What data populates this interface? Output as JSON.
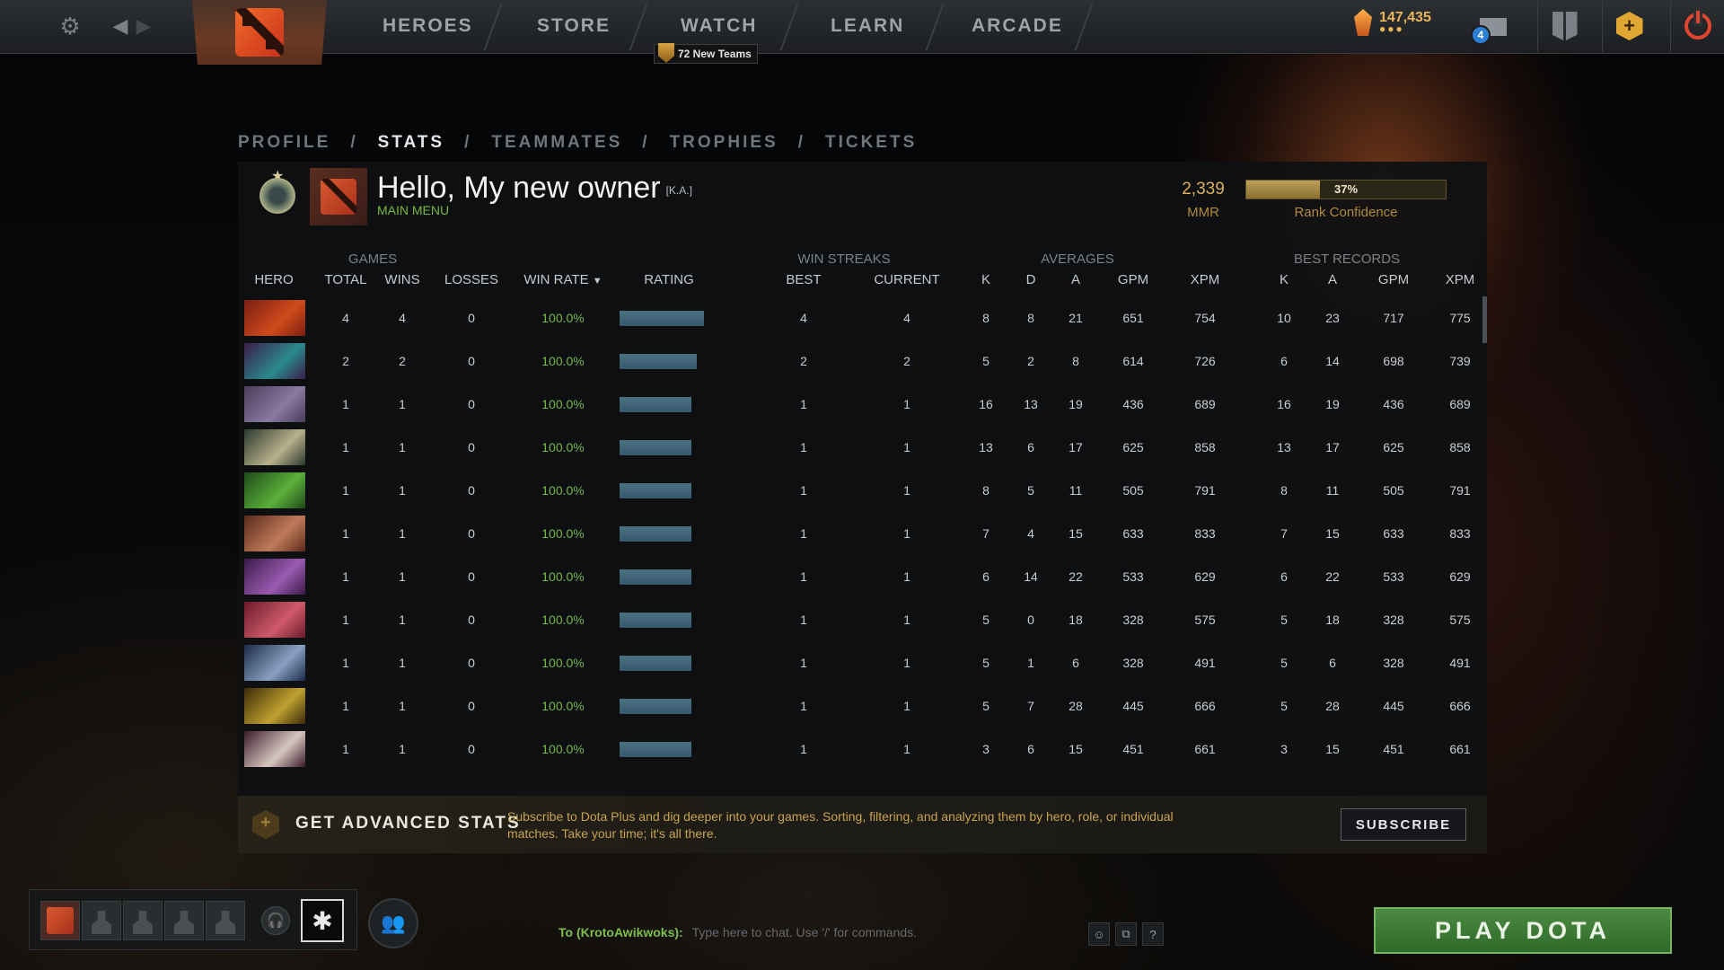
{
  "nav": {
    "items": [
      "HEROES",
      "STORE",
      "WATCH",
      "LEARN",
      "ARCADE"
    ],
    "new_teams": "72 New Teams",
    "shards": "147,435",
    "shard_dots": "●●●",
    "mail_count": "4"
  },
  "breadcrumb": {
    "items": [
      "PROFILE",
      "STATS",
      "TEAMMATES",
      "TROPHIES",
      "TICKETS"
    ],
    "separator": "/",
    "active": "STATS"
  },
  "profile": {
    "name": "Hello, My new owner",
    "tag": "[K.A.]",
    "status": "MAIN MENU",
    "mmr_value": "2,339",
    "mmr_label": "MMR",
    "confidence_pct": "37%",
    "confidence_fraction": 0.37,
    "confidence_label": "Rank Confidence"
  },
  "table": {
    "groups": {
      "games": "GAMES",
      "win_streaks": "WIN STREAKS",
      "averages": "AVERAGES",
      "best_records": "BEST RECORDS"
    },
    "headers": {
      "hero": "HERO",
      "total": "TOTAL",
      "wins": "WINS",
      "losses": "LOSSES",
      "win_rate": "WIN RATE",
      "rating": "RATING",
      "best": "BEST",
      "current": "CURRENT",
      "avg_k": "K",
      "avg_d": "D",
      "avg_a": "A",
      "avg_gpm": "GPM",
      "avg_xpm": "XPM",
      "rec_k": "K",
      "rec_a": "A",
      "rec_gpm": "GPM",
      "rec_xpm": "XPM"
    },
    "rows": [
      {
        "total": "4",
        "wins": "4",
        "losses": "0",
        "win_rate": "100.0%",
        "rating": 1.0,
        "best": "4",
        "current": "4",
        "k": "8",
        "d": "8",
        "a": "21",
        "gpm": "651",
        "xpm": "754",
        "rk": "10",
        "ra": "23",
        "rgpm": "717",
        "rxpm": "775",
        "colors": [
          "#7a1e14",
          "#d04b1c"
        ]
      },
      {
        "total": "2",
        "wins": "2",
        "losses": "0",
        "win_rate": "100.0%",
        "rating": 0.91,
        "best": "2",
        "current": "2",
        "k": "5",
        "d": "2",
        "a": "8",
        "gpm": "614",
        "xpm": "726",
        "rk": "6",
        "ra": "14",
        "rgpm": "698",
        "rxpm": "739",
        "colors": [
          "#3a1e4a",
          "#2a8a8c"
        ]
      },
      {
        "total": "1",
        "wins": "1",
        "losses": "0",
        "win_rate": "100.0%",
        "rating": 0.85,
        "best": "1",
        "current": "1",
        "k": "16",
        "d": "13",
        "a": "19",
        "gpm": "436",
        "xpm": "689",
        "rk": "16",
        "ra": "19",
        "rgpm": "436",
        "rxpm": "689",
        "colors": [
          "#4a3a5a",
          "#8a7aa0"
        ]
      },
      {
        "total": "1",
        "wins": "1",
        "losses": "0",
        "win_rate": "100.0%",
        "rating": 0.85,
        "best": "1",
        "current": "1",
        "k": "13",
        "d": "6",
        "a": "17",
        "gpm": "625",
        "xpm": "858",
        "rk": "13",
        "ra": "17",
        "rgpm": "625",
        "rxpm": "858",
        "colors": [
          "#2a3a2e",
          "#b8b08a"
        ]
      },
      {
        "total": "1",
        "wins": "1",
        "losses": "0",
        "win_rate": "100.0%",
        "rating": 0.85,
        "best": "1",
        "current": "1",
        "k": "8",
        "d": "5",
        "a": "11",
        "gpm": "505",
        "xpm": "791",
        "rk": "8",
        "ra": "11",
        "rgpm": "505",
        "rxpm": "791",
        "colors": [
          "#1e4a1a",
          "#5ab03a"
        ]
      },
      {
        "total": "1",
        "wins": "1",
        "losses": "0",
        "win_rate": "100.0%",
        "rating": 0.85,
        "best": "1",
        "current": "1",
        "k": "7",
        "d": "4",
        "a": "15",
        "gpm": "633",
        "xpm": "833",
        "rk": "7",
        "ra": "15",
        "rgpm": "633",
        "rxpm": "833",
        "colors": [
          "#5a2a1a",
          "#c07a5a"
        ]
      },
      {
        "total": "1",
        "wins": "1",
        "losses": "0",
        "win_rate": "100.0%",
        "rating": 0.85,
        "best": "1",
        "current": "1",
        "k": "6",
        "d": "14",
        "a": "22",
        "gpm": "533",
        "xpm": "629",
        "rk": "6",
        "ra": "22",
        "rgpm": "533",
        "rxpm": "629",
        "colors": [
          "#3a1a4a",
          "#9a5ab0"
        ]
      },
      {
        "total": "1",
        "wins": "1",
        "losses": "0",
        "win_rate": "100.0%",
        "rating": 0.85,
        "best": "1",
        "current": "1",
        "k": "5",
        "d": "0",
        "a": "18",
        "gpm": "328",
        "xpm": "575",
        "rk": "5",
        "ra": "18",
        "rgpm": "328",
        "rxpm": "575",
        "colors": [
          "#6a1a2a",
          "#d05a6a"
        ]
      },
      {
        "total": "1",
        "wins": "1",
        "losses": "0",
        "win_rate": "100.0%",
        "rating": 0.85,
        "best": "1",
        "current": "1",
        "k": "5",
        "d": "1",
        "a": "6",
        "gpm": "328",
        "xpm": "491",
        "rk": "5",
        "ra": "6",
        "rgpm": "328",
        "rxpm": "491",
        "colors": [
          "#1a2a4a",
          "#8aa0c0"
        ]
      },
      {
        "total": "1",
        "wins": "1",
        "losses": "0",
        "win_rate": "100.0%",
        "rating": 0.85,
        "best": "1",
        "current": "1",
        "k": "5",
        "d": "7",
        "a": "28",
        "gpm": "445",
        "xpm": "666",
        "rk": "5",
        "ra": "28",
        "rgpm": "445",
        "rxpm": "666",
        "colors": [
          "#3a2a0a",
          "#c0a030"
        ]
      },
      {
        "total": "1",
        "wins": "1",
        "losses": "0",
        "win_rate": "100.0%",
        "rating": 0.85,
        "best": "1",
        "current": "1",
        "k": "3",
        "d": "6",
        "a": "15",
        "gpm": "451",
        "xpm": "661",
        "rk": "3",
        "ra": "15",
        "rgpm": "451",
        "rxpm": "661",
        "colors": [
          "#3a1a2a",
          "#d8c8c0"
        ]
      }
    ]
  },
  "banner": {
    "title": "GET ADVANCED STATS",
    "description": "Subscribe to Dota Plus and dig deeper into your games. Sorting, filtering, and analyzing them by hero, role, or individual matches. Take your time; it's all there.",
    "button": "SUBSCRIBE"
  },
  "chat": {
    "to": "To (KrotoAwikwoks):",
    "placeholder": "Type here to chat. Use '/' for commands."
  },
  "play_button": "PLAY DOTA",
  "colors": {
    "accent_green": "#74b94a",
    "gold": "#d9b15c",
    "rating_bar": "#3f6476"
  }
}
